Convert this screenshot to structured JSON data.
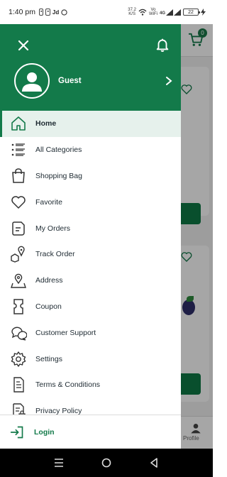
{
  "status_bar": {
    "time": "1:40 pm",
    "notif_text": "Jd",
    "network_speed_value": "37.2",
    "network_speed_unit": "K/S",
    "volte_top": "Vo",
    "volte_bottom": "WiFi",
    "signal_label": "4G",
    "battery": "22"
  },
  "drawer": {
    "profile": {
      "name": "Guest"
    },
    "menu_items": [
      {
        "label": "Home",
        "icon": "home-icon",
        "active": true
      },
      {
        "label": "All Categories",
        "icon": "categories-icon"
      },
      {
        "label": "Shopping Bag",
        "icon": "shopping-bag-icon"
      },
      {
        "label": "Favorite",
        "icon": "heart-icon"
      },
      {
        "label": "My Orders",
        "icon": "orders-icon"
      },
      {
        "label": "Track Order",
        "icon": "track-order-icon"
      },
      {
        "label": "Address",
        "icon": "address-icon"
      },
      {
        "label": "Coupon",
        "icon": "coupon-icon"
      },
      {
        "label": "Customer Support",
        "icon": "support-icon"
      },
      {
        "label": "Settings",
        "icon": "gear-icon"
      },
      {
        "label": "Terms & Conditions",
        "icon": "terms-icon"
      },
      {
        "label": "Privacy Policy",
        "icon": "privacy-icon"
      }
    ],
    "footer": {
      "label": "Login",
      "icon": "login-icon"
    }
  },
  "background_app": {
    "cart_badge": "0",
    "bottom_nav_profile_label": "Profile"
  },
  "colors": {
    "primary": "#137a4a",
    "active_bg": "#e6f1ec",
    "text": "#1e2a32"
  }
}
